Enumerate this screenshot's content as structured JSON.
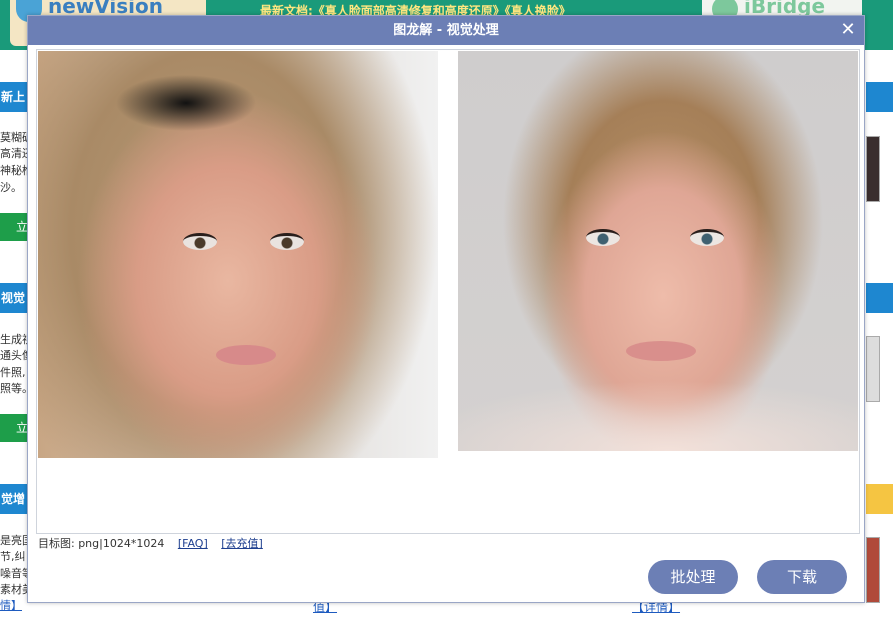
{
  "background": {
    "logo_left_text": "newVision",
    "news_text": "最新文档:《真人脸面部高清修复和高度还原》《真人换脸》",
    "logo_right_text": "iBridge",
    "side_sections": [
      {
        "heading": "新上",
        "lines": [
          "莫糊破",
          "高清还",
          "神秘椎",
          "沙。"
        ],
        "button": "立"
      },
      {
        "heading": "视觉",
        "lines": [
          "生成视",
          "通头像",
          "件照,",
          "照等。"
        ],
        "button": "立"
      },
      {
        "heading": "觉增",
        "lines": [
          "是亮国",
          "节,纠",
          "噪音等",
          "素材美",
          "情】"
        ],
        "button": ""
      }
    ],
    "bottom_links": [
      "值】",
      "【详情】"
    ]
  },
  "modal": {
    "title": "图龙解 - 视觉处理",
    "close_label": "✕",
    "target_info": "目标图: png|1024*1024",
    "faq_link": "[FAQ]",
    "recharge_link": "[去充值]",
    "batch_button": "批处理",
    "download_button": "下载"
  },
  "colors": {
    "title_bar": "#6c7fb5",
    "button": "#6c7fb5",
    "page_header": "#1a9a7a",
    "side_header": "#1e87d0",
    "side_button": "#1e9e4a"
  }
}
